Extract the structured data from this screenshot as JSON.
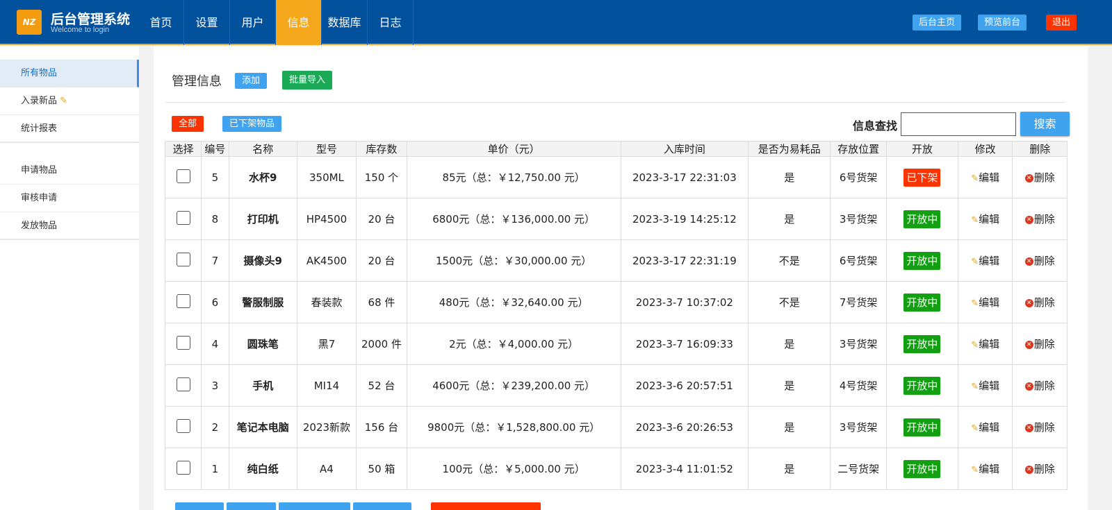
{
  "header": {
    "logo_text": "NZ",
    "title": "后台管理系统",
    "subtitle": "Welcome to login",
    "nav": [
      "首页",
      "设置",
      "用户",
      "信息",
      "数据库",
      "日志"
    ],
    "active_nav": "信息",
    "btn_admin_home": "后台主页",
    "btn_preview": "预览前台",
    "btn_logout": "退出"
  },
  "sidebar": {
    "group1": [
      "所有物品",
      "入录新品",
      "统计报表"
    ],
    "group2": [
      "申请物品",
      "审核申请",
      "发放物品"
    ]
  },
  "main": {
    "title": "管理信息",
    "btn_add": "添加",
    "btn_import": "批量导入",
    "filter_all": "全部",
    "filter_off": "已下架物品",
    "search_label": "信息查找",
    "search_value": "",
    "search_btn": "搜索"
  },
  "table": {
    "headers": [
      "选择",
      "编号",
      "名称",
      "型号",
      "库存数",
      "单价（元）",
      "入库时间",
      "是否为易耗品",
      "存放位置",
      "开放",
      "修改",
      "删除"
    ],
    "edit_label": "编辑",
    "delete_label": "删除",
    "rows": [
      {
        "id": "5",
        "name": "水杯9",
        "model": "350ML",
        "stock": "150 个",
        "price": "85元（总：￥12,750.00 元）",
        "time": "2023-3-17 22:31:03",
        "consumable": "是",
        "location": "6号货架",
        "status": "已下架"
      },
      {
        "id": "8",
        "name": "打印机",
        "model": "HP4500",
        "stock": "20 台",
        "price": "6800元（总：￥136,000.00 元）",
        "time": "2023-3-19 14:25:12",
        "consumable": "是",
        "location": "3号货架",
        "status": "开放中"
      },
      {
        "id": "7",
        "name": "摄像头9",
        "model": "AK4500",
        "stock": "20 台",
        "price": "1500元（总：￥30,000.00 元）",
        "time": "2023-3-17 22:31:19",
        "consumable": "不是",
        "location": "6号货架",
        "status": "开放中"
      },
      {
        "id": "6",
        "name": "警服制服",
        "model": "春装款",
        "stock": "68 件",
        "price": "480元（总：￥32,640.00 元）",
        "time": "2023-3-7 10:37:02",
        "consumable": "不是",
        "location": "7号货架",
        "status": "开放中"
      },
      {
        "id": "4",
        "name": "圆珠笔",
        "model": "黑7",
        "stock": "2000 件",
        "price": "2元（总：￥4,000.00 元）",
        "time": "2023-3-7 16:09:33",
        "consumable": "是",
        "location": "3号货架",
        "status": "开放中"
      },
      {
        "id": "3",
        "name": "手机",
        "model": "MI14",
        "stock": "52 台",
        "price": "4600元（总：￥239,200.00 元）",
        "time": "2023-3-6 20:57:51",
        "consumable": "是",
        "location": "4号货架",
        "status": "开放中"
      },
      {
        "id": "2",
        "name": "笔记本电脑",
        "model": "2023新款",
        "stock": "156 台",
        "price": "9800元（总：￥1,528,800.00 元）",
        "time": "2023-3-6 20:26:53",
        "consumable": "是",
        "location": "3号货架",
        "status": "开放中"
      },
      {
        "id": "1",
        "name": "纯白纸",
        "model": "A4",
        "stock": "50 箱",
        "price": "100元（总：￥5,000.00 元）",
        "time": "2023-3-4 11:01:52",
        "consumable": "是",
        "location": "二号货架",
        "status": "开放中"
      }
    ]
  },
  "colors": {
    "header_bg": "#02519d",
    "nav_active": "#f6a81c",
    "blue_btn": "#3fa3f0",
    "green_btn": "#1aaa55",
    "red_btn": "#ff3300",
    "status_open": "#12a012",
    "status_off": "#ff3300"
  }
}
